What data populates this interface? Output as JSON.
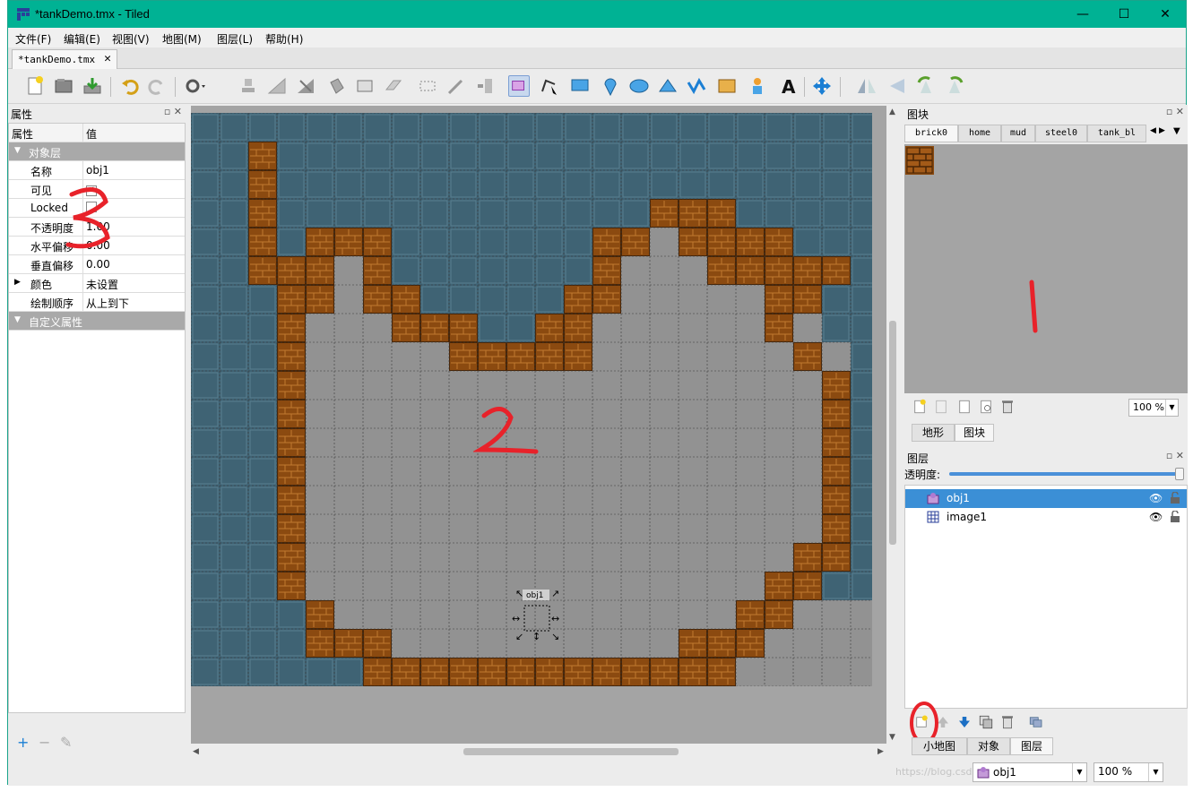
{
  "window": {
    "title": "*tankDemo.tmx - Tiled",
    "controls": {
      "minimize": "—",
      "maximize": "☐",
      "close": "✕"
    }
  },
  "menu": [
    "文件(F)",
    "编辑(E)",
    "视图(V)",
    "地图(M)",
    "图层(L)",
    "帮助(H)"
  ],
  "doc_tab": {
    "label": "*tankDemo.tmx",
    "close": "✕"
  },
  "properties": {
    "title": "属性",
    "col_key": "属性",
    "col_value": "值",
    "group_object_layer": "对象层",
    "rows": [
      {
        "key": "名称",
        "value": "obj1"
      },
      {
        "key": "可见",
        "value": "✓"
      },
      {
        "key": "Locked",
        "value": ""
      },
      {
        "key": "不透明度",
        "value": "1.00"
      },
      {
        "key": "水平偏移",
        "value": "0.00"
      },
      {
        "key": "垂直偏移",
        "value": "0.00"
      },
      {
        "key": "颜色",
        "value": "未设置"
      },
      {
        "key": "绘制顺序",
        "value": "从上到下"
      }
    ],
    "group_custom": "自定义属性",
    "bottom": {
      "add": "+",
      "remove": "−",
      "edit": "✎"
    }
  },
  "tilesets": {
    "title": "图块",
    "tabs": [
      "brick0",
      "home",
      "mud",
      "steel0",
      "tank_bl"
    ],
    "zoom": "100 %",
    "subtabs": [
      "地形",
      "图块"
    ]
  },
  "layers": {
    "title": "图层",
    "opacity_label": "透明度:",
    "opacity": 1.0,
    "items": [
      {
        "name": "obj1",
        "type": "object",
        "selected": true
      },
      {
        "name": "image1",
        "type": "tile",
        "selected": false
      }
    ],
    "bottom_tabs": [
      "小地图",
      "对象",
      "图层"
    ]
  },
  "map": {
    "object_label": "obj1"
  },
  "status": {
    "layer": "obj1",
    "zoom": "100 %",
    "watermark": "https://blog.csdn.net/..."
  },
  "annotations": [
    "1",
    "2",
    "3"
  ],
  "colors": {
    "title_bar": "#00b294",
    "water": "#3f6374",
    "brick": "#8b4a10",
    "floor": "#929292",
    "selection": "#3b8fd6",
    "annotation": "#e8222a"
  }
}
